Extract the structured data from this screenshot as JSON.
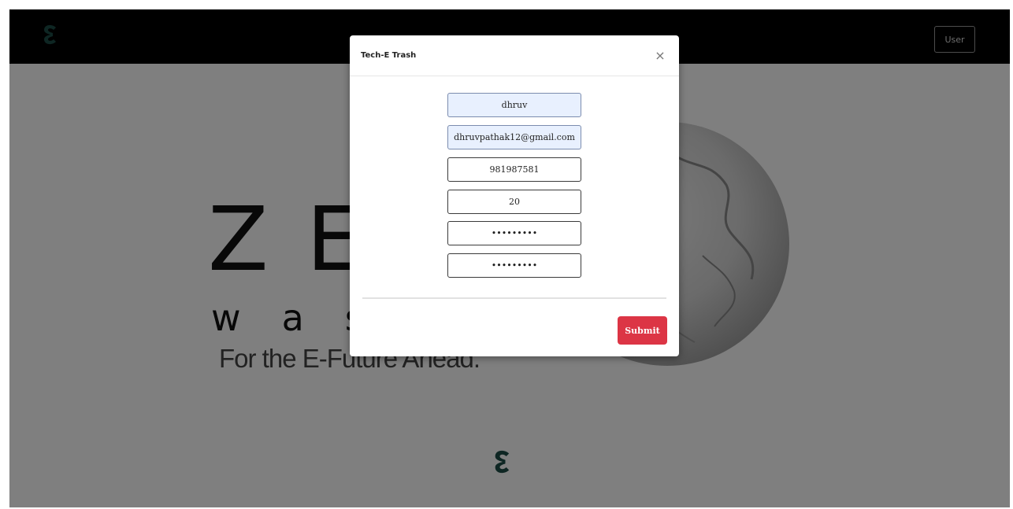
{
  "navbar": {
    "button_label": "User"
  },
  "hero": {
    "title": "ZERO",
    "subtitle": "waste",
    "tagline": "For the E-Future Ahead."
  },
  "modal": {
    "title": "Tech-E Trash",
    "close_label": "×",
    "fields": {
      "name": "dhruv",
      "email": "dhruvpathak12@gmail.com",
      "phone": "981987581",
      "age": "20",
      "password": "password1",
      "confirm_password": "password1"
    },
    "submit_label": "Submit"
  },
  "colors": {
    "navbar_bg": "#000000",
    "logo_green": "#1d4d46",
    "submit_bg": "#dc3545",
    "autofill_bg": "#e8f0fe"
  },
  "icons": {
    "brand_logo": "e-logo-icon",
    "close": "close-icon"
  }
}
